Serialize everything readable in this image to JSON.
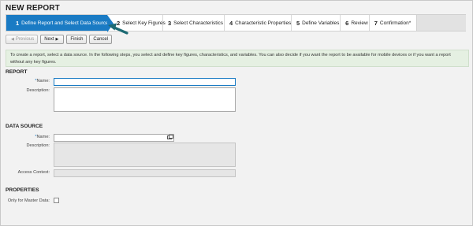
{
  "page": {
    "title": "NEW REPORT"
  },
  "steps": [
    {
      "num": "1",
      "label": "Define Report and Select Data Source*"
    },
    {
      "num": "2",
      "label": "Select Key Figures"
    },
    {
      "num": "3",
      "label": "Select Characteristics"
    },
    {
      "num": "4",
      "label": "Characteristic Properties"
    },
    {
      "num": "5",
      "label": "Define Variables"
    },
    {
      "num": "6",
      "label": "Review"
    },
    {
      "num": "7",
      "label": "Confirmation*"
    }
  ],
  "toolbar": {
    "previous_label": "Previous",
    "next_label": "Next",
    "finish_label": "Finish",
    "cancel_label": "Cancel"
  },
  "info": {
    "text": "To create a report, select a data source. In the following steps, you select and define key figures, characteristics, and variables. You can also decide if you want the report to be available for mobile devices or if you want a report without any key figures."
  },
  "report": {
    "heading": "REPORT",
    "name_label": "Name:",
    "name_value": "",
    "description_label": "Description:",
    "description_value": ""
  },
  "data_source": {
    "heading": "DATA SOURCE",
    "name_label": "Name:",
    "name_value": "",
    "description_label": "Description:",
    "access_context_label": "Access Context:"
  },
  "properties": {
    "heading": "PROPERTIES",
    "master_data_label": "Only for Master Data:"
  },
  "colors": {
    "active_step": "#1a7bc4",
    "info_bg": "#e5f0e2",
    "annotation_arrow": "#1d6a73"
  }
}
